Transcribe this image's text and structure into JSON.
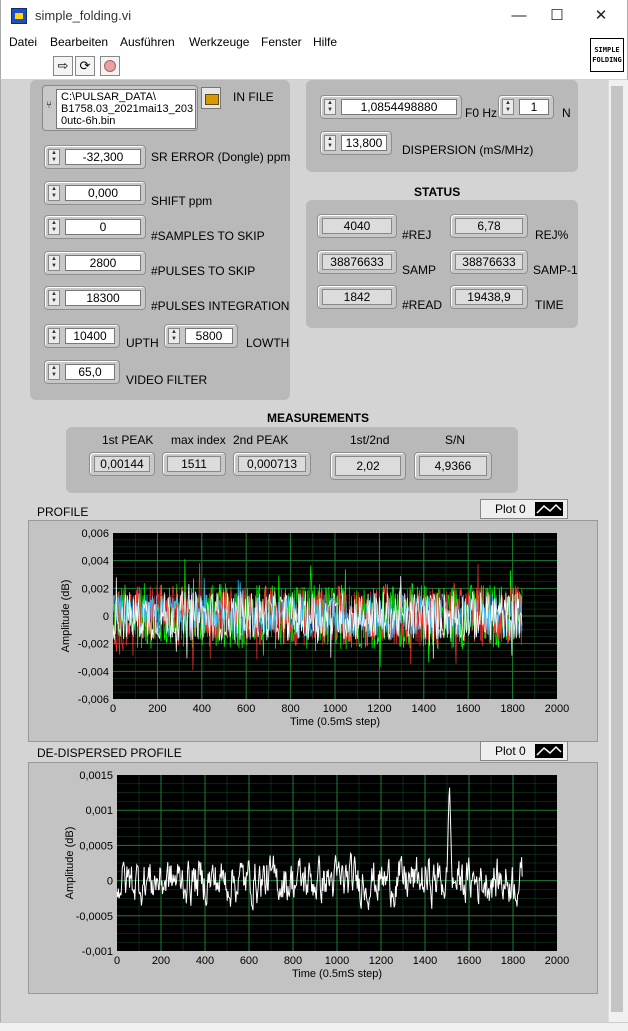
{
  "window": {
    "title": "simple_folding.vi",
    "minimize": "—",
    "maximize": "☐",
    "close": "✕"
  },
  "menu": [
    "Datei",
    "Bearbeiten",
    "Ausführen",
    "Werkzeuge",
    "Fenster",
    "Hilfe"
  ],
  "toolbar": {
    "run_icon": "run-arrow-icon",
    "run_continuous_icon": "run-continuous-icon",
    "abort_icon": "abort-icon"
  },
  "vi_icon": {
    "line1": "SIMPLE",
    "line2": "FOLDING"
  },
  "inputs": {
    "in_file": {
      "label": "IN FILE",
      "value": "C:\\PULSAR_DATA\\\nB1758.03_2021mai13_203\n0utc-6h.bin"
    },
    "sr_error": {
      "label": "SR ERROR (Dongle) ppm",
      "value": "-32,300"
    },
    "shift": {
      "label": "SHIFT ppm",
      "value": "0,000"
    },
    "samples_skip": {
      "label": "#SAMPLES TO SKIP",
      "value": "0"
    },
    "pulses_skip": {
      "label": "#PULSES TO SKIP",
      "value": "2800"
    },
    "pulses_integration": {
      "label": "#PULSES INTEGRATION",
      "value": "18300"
    },
    "upth": {
      "label": "UPTH",
      "value": "10400"
    },
    "lowth": {
      "label": "LOWTH",
      "value": "5800"
    },
    "video_filter": {
      "label": "VIDEO FILTER",
      "value": "65,0"
    },
    "f0": {
      "label": "F0 Hz",
      "value": "1,0854498880"
    },
    "n": {
      "label": "N",
      "value": "1"
    },
    "dispersion": {
      "label": "DISPERSION (mS/MHz)",
      "value": "13,800"
    }
  },
  "status": {
    "title": "STATUS",
    "rej": {
      "label": "#REJ",
      "value": "4040"
    },
    "rej_pct": {
      "label": "REJ%",
      "value": "6,78"
    },
    "samp": {
      "label": "SAMP",
      "value": "38876633"
    },
    "samp_1": {
      "label": "SAMP-1",
      "value": "38876633"
    },
    "read": {
      "label": "#READ",
      "value": "1842"
    },
    "time": {
      "label": "TIME",
      "value": "19438,9"
    }
  },
  "measurements": {
    "title": "MEASUREMENTS",
    "first_peak": {
      "label": "1st PEAK",
      "value": "0,00144"
    },
    "max_index": {
      "label": "max index",
      "value": "1511"
    },
    "second_peak": {
      "label": "2nd PEAK",
      "value": "0,000713"
    },
    "ratio": {
      "label": "1st/2nd",
      "value": "2,02"
    },
    "sn": {
      "label": "S/N",
      "value": "4,9366"
    }
  },
  "chart_data": [
    {
      "type": "line",
      "title": "PROFILE",
      "legend": "Plot 0",
      "xlabel": "Time (0.5mS step)",
      "ylabel": "Amplitude (dB)",
      "xlim": [
        0,
        2000
      ],
      "ylim": [
        -0.006,
        0.006
      ],
      "x_ticks": [
        "0",
        "200",
        "400",
        "600",
        "800",
        "1000",
        "1200",
        "1400",
        "1600",
        "1800",
        "2000"
      ],
      "y_ticks": [
        "0,006",
        "0,004",
        "0,002",
        "0",
        "-0,002",
        "-0,004",
        "-0,006"
      ],
      "grid": true,
      "background": "#000000",
      "grid_color": "#1f8a3a",
      "series": [
        {
          "color": "#00ff00",
          "n_points": 1842,
          "amplitude": 0.0024
        },
        {
          "color": "#ff3030",
          "n_points": 1842,
          "amplitude": 0.0022
        },
        {
          "color": "#40c0ff",
          "n_points": 1842,
          "amplitude": 0.0016
        },
        {
          "color": "#ffffff",
          "n_points": 1842,
          "amplitude": 0.0018
        }
      ]
    },
    {
      "type": "line",
      "title": "DE-DISPERSED PROFILE",
      "legend": "Plot 0",
      "xlabel": "Time (0.5mS step)",
      "ylabel": "Amplitude (dB)",
      "xlim": [
        0,
        2000
      ],
      "ylim": [
        -0.001,
        0.0015
      ],
      "x_ticks": [
        "0",
        "200",
        "400",
        "600",
        "800",
        "1000",
        "1200",
        "1400",
        "1600",
        "1800",
        "2000"
      ],
      "y_ticks": [
        "0,0015",
        "0,001",
        "0,0005",
        "0",
        "-0,0005",
        "-0,001"
      ],
      "grid": true,
      "background": "#000000",
      "grid_color": "#1f8a3a",
      "series": [
        {
          "color": "#ffffff",
          "n_points": 1842,
          "peak_x": 1511,
          "peak_y": 0.00144,
          "amplitude": 0.00028
        }
      ]
    }
  ]
}
